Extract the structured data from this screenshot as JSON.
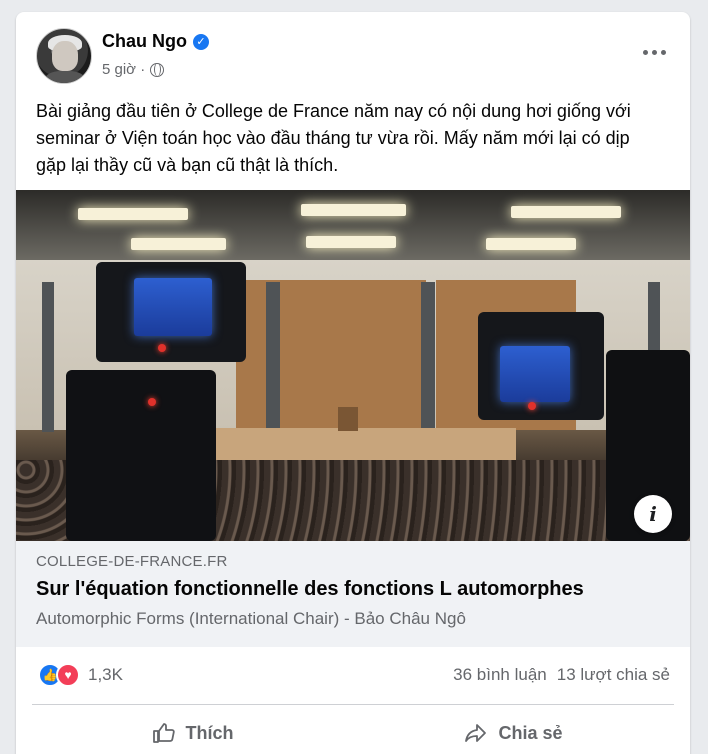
{
  "post": {
    "author": "Chau Ngo",
    "time": "5 giờ ·",
    "text": "Bài giảng đầu tiên ở College de France năm nay có nội dung hơi giống với seminar ở Viện toán học vào đầu tháng tư vừa rồi. Mấy năm mới lại có dịp gặp lại thầy cũ và bạn cũ thật là thích."
  },
  "link": {
    "domain": "COLLEGE-DE-FRANCE.FR",
    "title": "Sur l'équation fonctionnelle des fonctions L automorphes",
    "subtitle": "Automorphic Forms (International Chair) - Bảo Châu Ngô",
    "info_icon": "i"
  },
  "stats": {
    "reaction_count": "1,3K",
    "comments": "36 bình luận",
    "shares": "13 lượt chia sẻ"
  },
  "actions": {
    "like": "Thích",
    "share": "Chia sẻ"
  },
  "colors": {
    "accent": "#1877f2",
    "love": "#f33e58",
    "muted_text": "#65676b"
  }
}
